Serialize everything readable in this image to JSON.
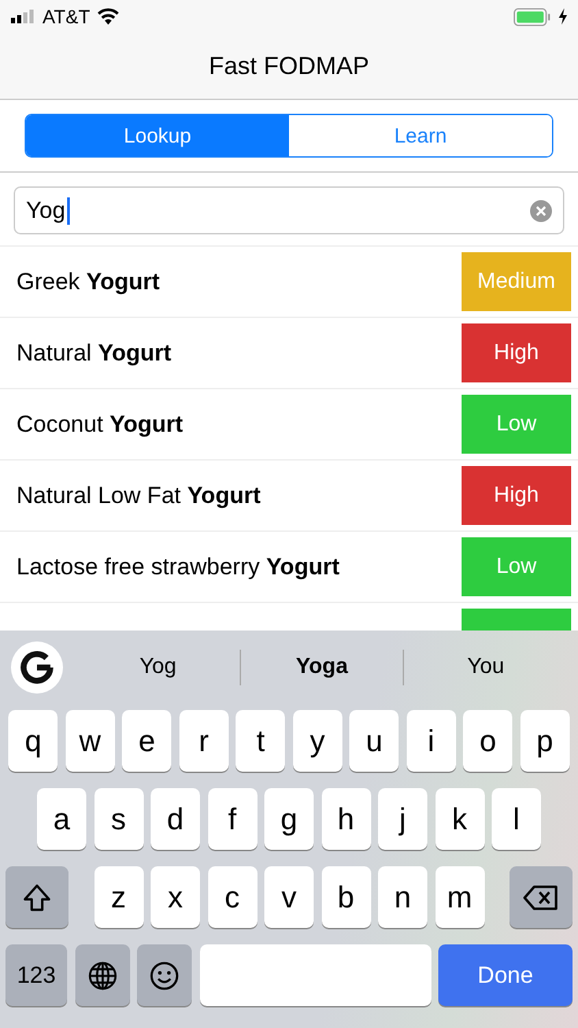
{
  "status_bar": {
    "carrier": "AT&T"
  },
  "nav": {
    "title": "Fast FODMAP"
  },
  "tabs": [
    {
      "label": "Lookup",
      "selected": true
    },
    {
      "label": "Learn",
      "selected": false
    }
  ],
  "search": {
    "value": "Yog"
  },
  "foods": [
    {
      "name": "Greek **Yogurt**",
      "rating": "Medium",
      "color": "#e6b31e"
    },
    {
      "name": "Natural **Yogurt**",
      "rating": "High",
      "color": "#d93232"
    },
    {
      "name": "Coconut **Yogurt**",
      "rating": "Low",
      "color": "#2ecc40"
    },
    {
      "name": "Natural Low Fat **Yogurt**",
      "rating": "High",
      "color": "#d93232"
    },
    {
      "name": "Lactose free strawberry **Yogurt**",
      "rating": "Low",
      "color": "#2ecc40"
    },
    {
      "color": "#2ecc40"
    }
  ],
  "suggestions": [
    {
      "text": "Yog",
      "selected": false
    },
    {
      "text": "Yoga",
      "selected": true
    },
    {
      "text": "You",
      "selected": false
    }
  ],
  "keyboard": {
    "rows": [
      [
        "q",
        "w",
        "e",
        "r",
        "t",
        "y",
        "u",
        "i",
        "o",
        "p"
      ],
      [
        "a",
        "s",
        "d",
        "f",
        "g",
        "h",
        "j",
        "k",
        "l"
      ],
      [
        "z",
        "x",
        "c",
        "v",
        "b",
        "n",
        "m"
      ]
    ],
    "numbers_key": "123",
    "done_key": "Done"
  }
}
